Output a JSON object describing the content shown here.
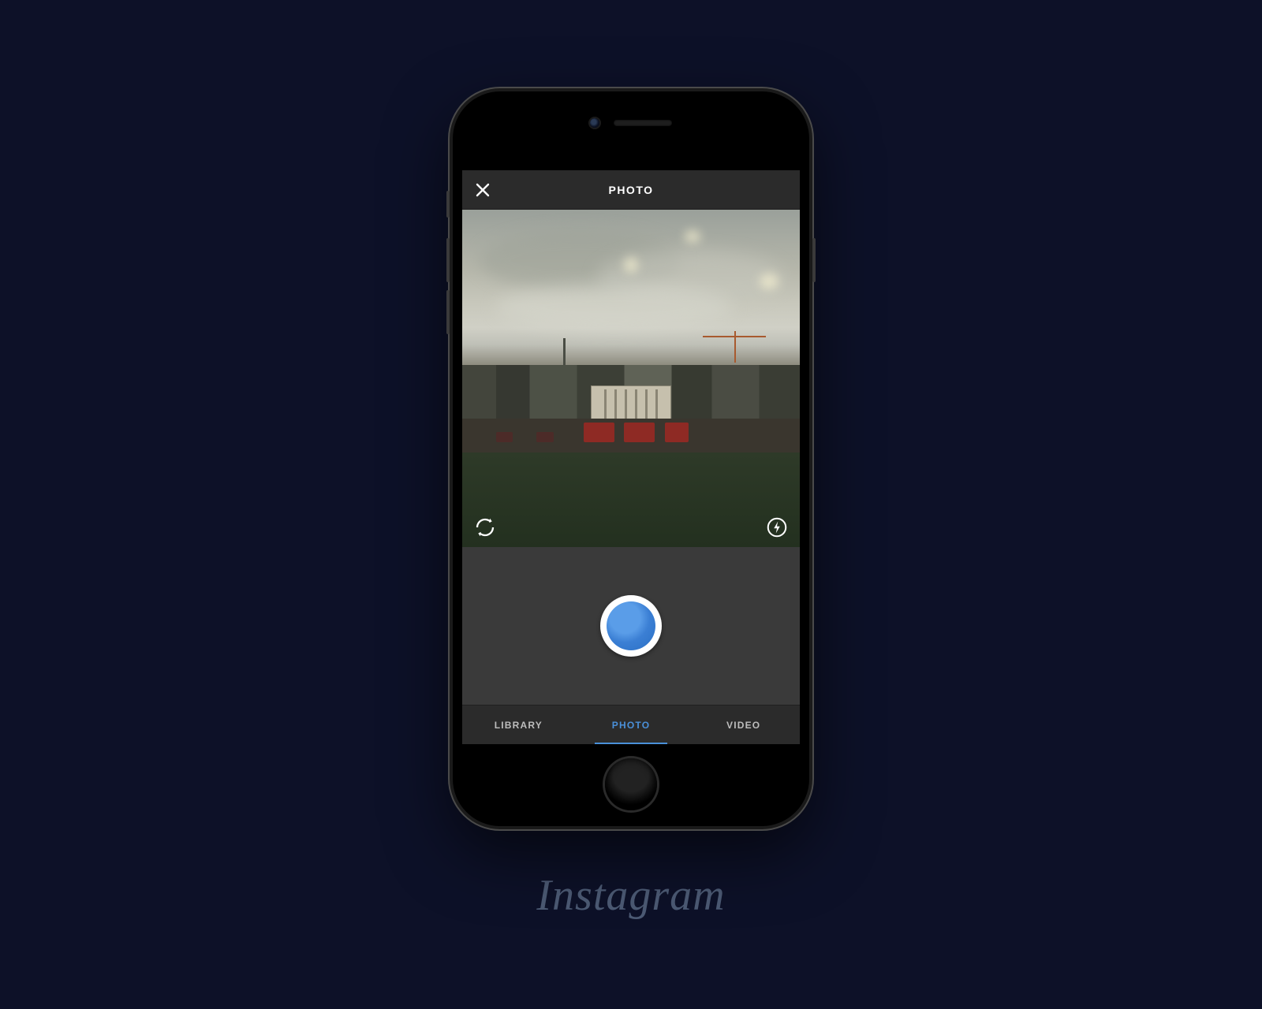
{
  "header": {
    "title": "PHOTO",
    "close_icon": "close-icon"
  },
  "viewfinder": {
    "switch_camera_icon": "switch-camera-icon",
    "flash_icon": "flash-icon"
  },
  "shutter": {
    "label": "shutter"
  },
  "tabs": [
    {
      "label": "LIBRARY",
      "active": false
    },
    {
      "label": "PHOTO",
      "active": true
    },
    {
      "label": "VIDEO",
      "active": false
    }
  ],
  "brand": "Instagram",
  "colors": {
    "background": "#0d1128",
    "accent": "#4a90d9",
    "shutter": "#3b7fd4"
  }
}
